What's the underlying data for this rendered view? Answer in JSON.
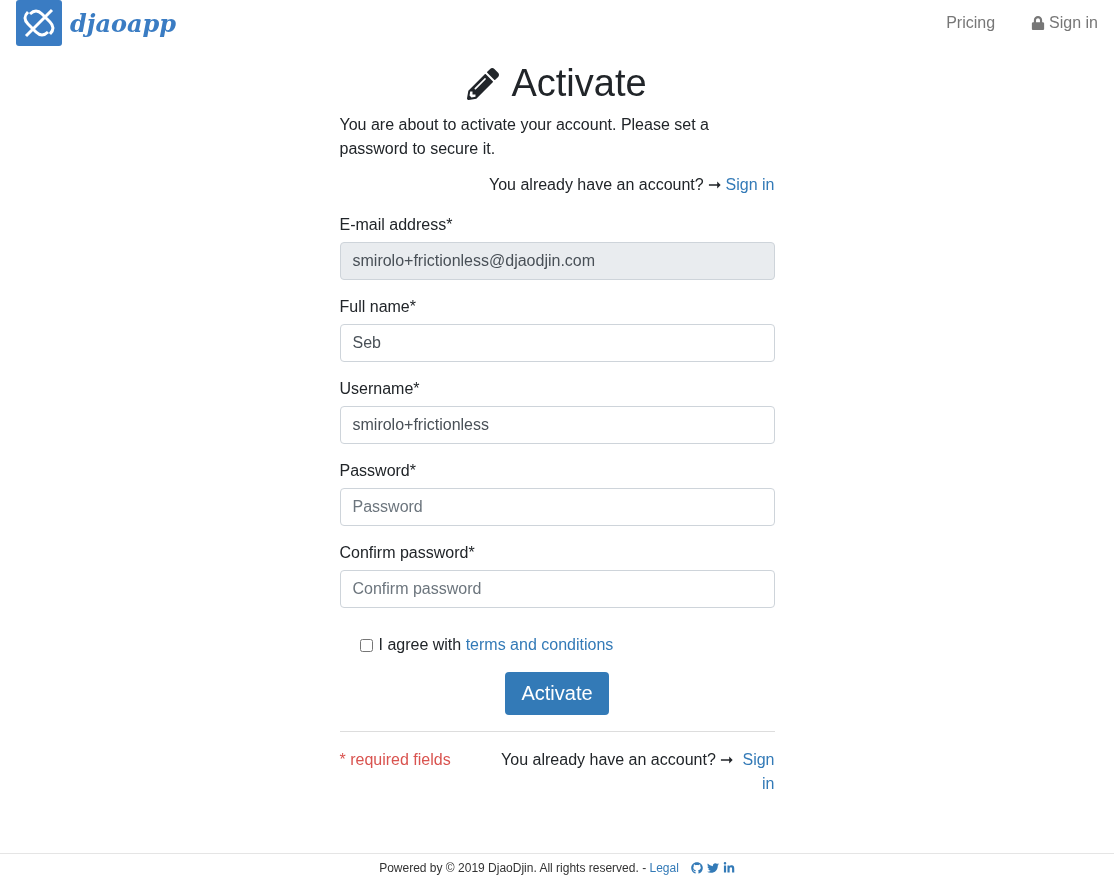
{
  "navbar": {
    "logo_text": "djaoapp",
    "links": [
      {
        "label": "Pricing",
        "locked": false
      },
      {
        "label": "Sign in",
        "locked": true
      }
    ]
  },
  "title": "Activate",
  "intro": "You are about to activate your account. Please set a password to secure it.",
  "signin_prompt": {
    "text": "You already have an account? ➞",
    "link": "Sign in"
  },
  "fields": [
    {
      "label": "E-mail address*",
      "value": "smirolo+frictionless@djaodjin.com",
      "disabled": true
    },
    {
      "label": "Full name*",
      "value": "Seb",
      "disabled": false
    },
    {
      "label": "Username*",
      "value": "smirolo+frictionless",
      "disabled": false
    },
    {
      "label": "Password*",
      "placeholder": "Password",
      "disabled": false
    },
    {
      "label": "Confirm password*",
      "placeholder": "Confirm password",
      "disabled": false
    }
  ],
  "terms": {
    "checked": false,
    "text": "I agree with",
    "link": "terms and conditions"
  },
  "submit": "Activate",
  "required_note": "* required fields",
  "bottom_signin": {
    "text": "You already have an account? ➞",
    "link": "Sign in"
  },
  "footer": {
    "text": "Powered by © 2019 DjaoDjin. All rights reserved. -",
    "link": "Legal"
  }
}
